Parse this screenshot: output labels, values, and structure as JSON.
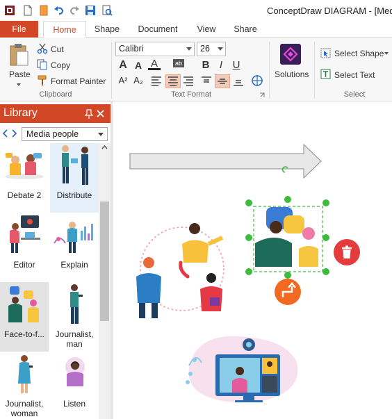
{
  "window": {
    "title": "ConceptDraw DIAGRAM - [Media"
  },
  "tabs": [
    {
      "label": "File"
    },
    {
      "label": "Home"
    },
    {
      "label": "Shape"
    },
    {
      "label": "Document"
    },
    {
      "label": "View"
    },
    {
      "label": "Share"
    }
  ],
  "clipboard": {
    "paste": "Paste",
    "cut": "Cut",
    "copy": "Copy",
    "format_painter": "Format Painter",
    "group_label": "Clipboard"
  },
  "text_format": {
    "font": "Calibri",
    "size": "26",
    "group_label": "Text Format"
  },
  "solutions": {
    "label": "Solutions"
  },
  "select": {
    "select_shape": "Select Shape",
    "select_text": "Select Text",
    "group_label": "Select"
  },
  "library": {
    "title": "Library",
    "dropdown": "Media people",
    "items": [
      {
        "label": "Debate 2"
      },
      {
        "label": "Distribute"
      },
      {
        "label": "Editor"
      },
      {
        "label": "Explain"
      },
      {
        "label": "Face-to-f..."
      },
      {
        "label": "Journalist,",
        "label2": "man"
      },
      {
        "label": "Journalist,",
        "label2": "woman"
      },
      {
        "label": "Listen"
      }
    ]
  },
  "colors": {
    "accent": "#d24726",
    "selection_handle": "#3dbb3d",
    "delete_button": "#e43c3c",
    "connector_button": "#f26a21"
  }
}
